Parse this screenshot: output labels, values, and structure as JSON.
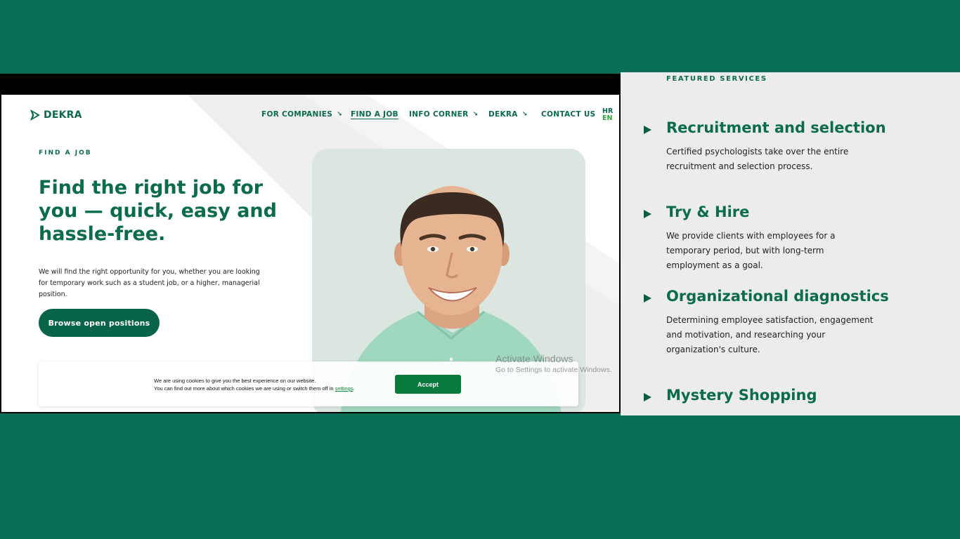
{
  "site": {
    "logo_text": "DEKRA",
    "nav": [
      {
        "label": "FOR COMPANIES",
        "arrow": "↘"
      },
      {
        "label": "FIND A JOB"
      },
      {
        "label": "INFO CORNER",
        "arrow": "↘"
      },
      {
        "label": "DEKRA",
        "arrow": "↘"
      },
      {
        "label": "CONTACT US"
      }
    ],
    "lang": {
      "hr": "HR",
      "en": "EN"
    },
    "eyebrow": "FIND A JOB",
    "hero_title": "Find the right job for you — quick, easy and hassle-free.",
    "hero_desc": "We will find the right opportunity for you, whether you are looking for temporary work such as a student job, or a higher, managerial position.",
    "cta": "Browse open positions"
  },
  "cookie": {
    "line1": "We are using cookies to give you the best experience on our website.",
    "line2": "You can find out more about which cookies we are using or switch them off in",
    "link": "settings",
    "end": ".",
    "accept": "Accept"
  },
  "watermark": {
    "title": "Activate Windows",
    "subtitle": "Go to Settings to activate Windows."
  },
  "services_panel": {
    "eyebrow": "FEATURED SERVICES",
    "items": [
      {
        "title": "Recruitment and selection",
        "desc": "Certified psychologists take over the entire recruitment and selection process."
      },
      {
        "title": "Try & Hire",
        "desc": "We provide clients with employees for a temporary period, but with long-term employment as a goal."
      },
      {
        "title": "Organizational diagnostics",
        "desc": "Determining employee satisfaction, engagement and motivation, and researching your organization's culture."
      },
      {
        "title": "Mystery Shopping",
        "desc": ""
      }
    ]
  },
  "colors": {
    "background": "#086e54",
    "brand_green": "#0b6b4d",
    "button_green": "#086448",
    "accept_green": "#0a7a3c",
    "panel_bg": "#ececec"
  }
}
